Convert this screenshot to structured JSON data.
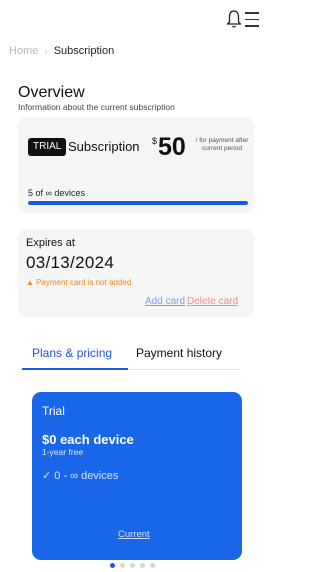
{
  "header": {
    "bell_icon": "bell-icon",
    "menu_icon": "hamburger-menu-icon"
  },
  "breadcrumb": {
    "home": "Home",
    "separator_icon": "chevron-right-icon",
    "current": "Subscription"
  },
  "overview": {
    "title": "Overview",
    "subtitle": "Information about the current subscription"
  },
  "subscription_card": {
    "badge": "TRIAL",
    "label": "Subscription",
    "currency": "$",
    "price": "50",
    "price_note": "/ for payment after current period",
    "devices_text": "5 of ∞ devices",
    "usage_fraction": 1.0
  },
  "expiry_card": {
    "label": "Expires at",
    "date": "03/13/2024",
    "warning": "Payment card is not added",
    "warning_icon": "warning-icon",
    "add_card": "Add card",
    "delete_card": "Delete card"
  },
  "tabs": [
    {
      "label": "Plans & pricing",
      "active": true
    },
    {
      "label": "Payment history",
      "active": false
    }
  ],
  "plan": {
    "name": "Trial",
    "price": "$0 each device",
    "free_period": "1-year free",
    "devices": "0 - ∞ devices",
    "check_icon": "check-icon",
    "action": "Current"
  },
  "carousel": {
    "count": 5,
    "active_index": 0
  },
  "colors": {
    "accent": "#1a56e8",
    "plan_card": "#1a66e8",
    "warning": "#ec8a22",
    "delete": "#ef8b8b",
    "add": "#7d9fe8"
  }
}
